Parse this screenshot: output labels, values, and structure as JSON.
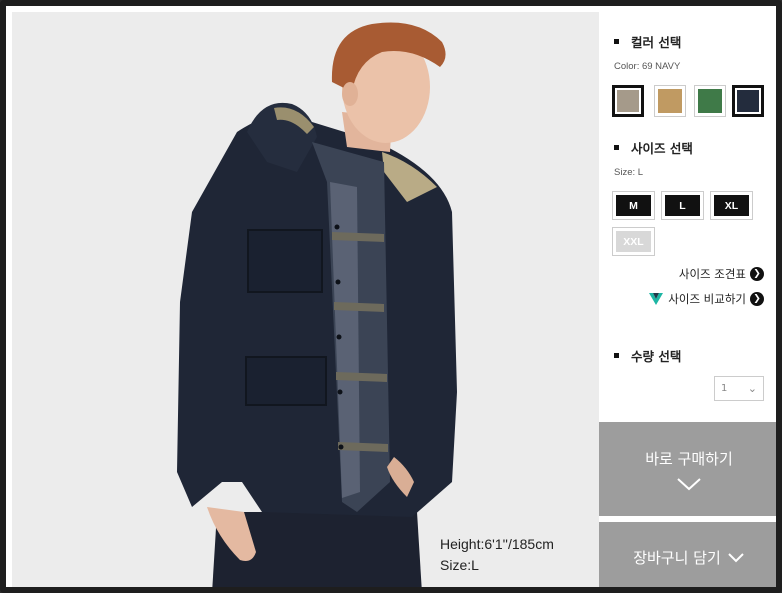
{
  "product_image": {
    "model_height": "Height:6'1''/185cm",
    "model_size": "Size:L"
  },
  "color_section": {
    "title": "컬러 선택",
    "selected_label": "Color: 69 NAVY",
    "swatches": [
      {
        "name": "beige",
        "color": "#a59a8a",
        "selected": true
      },
      {
        "name": "tan",
        "color": "#c09a62",
        "selected": false
      },
      {
        "name": "green",
        "color": "#3f7a48",
        "selected": false
      },
      {
        "name": "navy",
        "color": "#232c3d",
        "selected": true
      }
    ]
  },
  "size_section": {
    "title": "사이즈 선택",
    "selected_label": "Size: L",
    "sizes": [
      {
        "label": "M",
        "available": true
      },
      {
        "label": "L",
        "available": true
      },
      {
        "label": "XL",
        "available": true
      },
      {
        "label": "XXL",
        "available": false
      }
    ],
    "size_chart_link": "사이즈 조견표",
    "size_compare_link": "사이즈 비교하기"
  },
  "quantity_section": {
    "title": "수량 선택",
    "value": "1"
  },
  "actions": {
    "buy_now": "바로 구매하기",
    "add_to_cart": "장바구니 담기"
  },
  "colors": {
    "jacket": "#1f2636",
    "button_bg": "#9d9d9d",
    "logo_accent": "#1db6a4"
  }
}
